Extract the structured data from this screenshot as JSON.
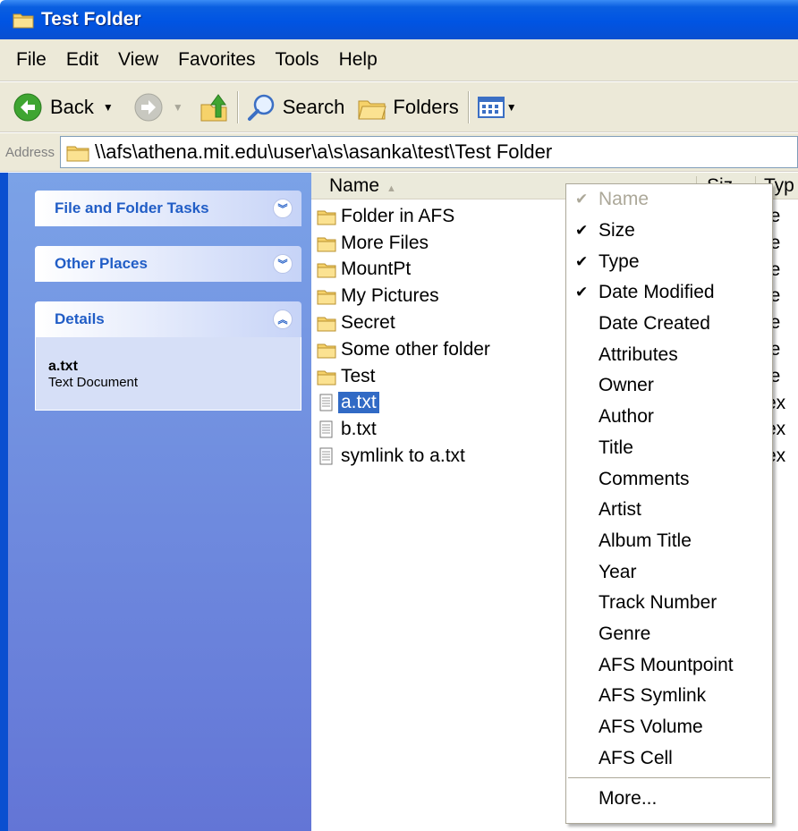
{
  "window": {
    "title": "Test Folder"
  },
  "menu": [
    "File",
    "Edit",
    "View",
    "Favorites",
    "Tools",
    "Help"
  ],
  "toolbar": {
    "back_label": "Back",
    "search_label": "Search",
    "folders_label": "Folders"
  },
  "address": {
    "label": "Address",
    "path": "\\\\afs\\athena.mit.edu\\user\\a\\s\\asanka\\test\\Test Folder"
  },
  "taskpane": {
    "file_tasks": "File and Folder Tasks",
    "other_places": "Other Places",
    "details": "Details",
    "detail_name": "a.txt",
    "detail_type": "Text Document"
  },
  "columns": {
    "name": "Name",
    "size": "Siz",
    "type": "Typ"
  },
  "files": [
    {
      "name": "Folder in AFS",
      "kind": "folder",
      "type_frag": "le"
    },
    {
      "name": "More Files",
      "kind": "folder",
      "type_frag": "le"
    },
    {
      "name": "MountPt",
      "kind": "folder",
      "type_frag": "le"
    },
    {
      "name": "My Pictures",
      "kind": "folder",
      "type_frag": "le"
    },
    {
      "name": "Secret",
      "kind": "folder",
      "type_frag": "le"
    },
    {
      "name": "Some other folder",
      "kind": "folder",
      "type_frag": "le"
    },
    {
      "name": "Test",
      "kind": "folder",
      "type_frag": "le"
    },
    {
      "name": "a.txt",
      "kind": "text",
      "type_frag": "ex",
      "selected": true
    },
    {
      "name": "b.txt",
      "kind": "text",
      "type_frag": "ex"
    },
    {
      "name": "symlink to a.txt",
      "kind": "text",
      "type_frag": "ex"
    }
  ],
  "context_menu": {
    "items": [
      {
        "label": "Name",
        "checked": true,
        "disabled": true
      },
      {
        "label": "Size",
        "checked": true
      },
      {
        "label": "Type",
        "checked": true
      },
      {
        "label": "Date Modified",
        "checked": true
      },
      {
        "label": "Date Created"
      },
      {
        "label": "Attributes"
      },
      {
        "label": "Owner"
      },
      {
        "label": "Author"
      },
      {
        "label": "Title"
      },
      {
        "label": "Comments"
      },
      {
        "label": "Artist"
      },
      {
        "label": "Album Title"
      },
      {
        "label": "Year"
      },
      {
        "label": "Track Number"
      },
      {
        "label": "Genre"
      },
      {
        "label": "AFS Mountpoint"
      },
      {
        "label": "AFS Symlink"
      },
      {
        "label": "AFS Volume"
      },
      {
        "label": "AFS Cell"
      }
    ],
    "more_label": "More..."
  },
  "colors": {
    "title_blue": "#0054e3",
    "selection": "#316ac5",
    "taskpane": "#6f8ee0"
  },
  "icons": [
    "folder-icon",
    "text-file-icon",
    "back-arrow-icon",
    "forward-arrow-icon",
    "up-folder-icon",
    "search-icon",
    "folders-icon",
    "views-icon",
    "check-icon"
  ]
}
